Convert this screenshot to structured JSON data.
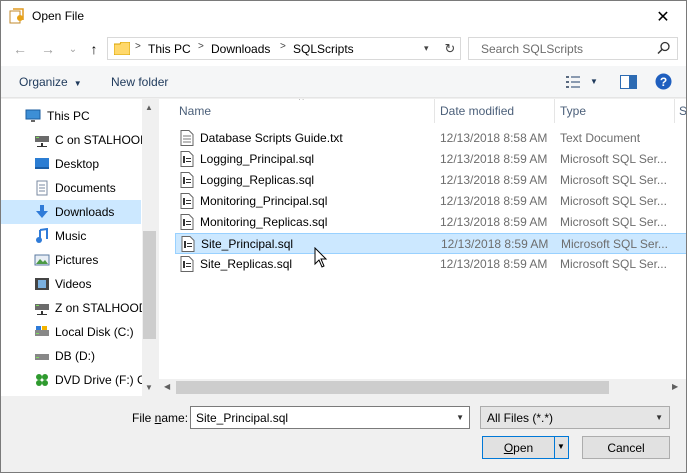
{
  "window": {
    "title": "Open File",
    "close": "✕"
  },
  "nav": {
    "back": "←",
    "forward": "→",
    "recent": "⌄",
    "up": "↑",
    "breadcrumbs": [
      "This PC",
      "Downloads",
      "SQLScripts"
    ],
    "search_placeholder": "Search SQLScripts"
  },
  "toolbar": {
    "organize": "Organize",
    "new_folder": "New folder"
  },
  "sidebar": {
    "items": [
      {
        "label": "This PC",
        "icon": "monitor-icon",
        "root": true
      },
      {
        "label": "C on STALHOOD",
        "icon": "network-drive-icon"
      },
      {
        "label": "Desktop",
        "icon": "desktop-icon"
      },
      {
        "label": "Documents",
        "icon": "documents-icon"
      },
      {
        "label": "Downloads",
        "icon": "downloads-icon",
        "selected": true
      },
      {
        "label": "Music",
        "icon": "music-icon"
      },
      {
        "label": "Pictures",
        "icon": "pictures-icon"
      },
      {
        "label": "Videos",
        "icon": "videos-icon"
      },
      {
        "label": "Z on STALHOOD",
        "icon": "network-drive-icon"
      },
      {
        "label": "Local Disk (C:)",
        "icon": "local-disk-icon"
      },
      {
        "label": "DB (D:)",
        "icon": "drive-icon"
      },
      {
        "label": "DVD Drive (F:) C\\",
        "icon": "dvd-drive-icon"
      }
    ]
  },
  "columns": {
    "name": "Name",
    "date": "Date modified",
    "type": "Type",
    "size": "S"
  },
  "files": [
    {
      "name": "Database Scripts Guide.txt",
      "date": "12/13/2018 8:58 AM",
      "type": "Text Document"
    },
    {
      "name": "Logging_Principal.sql",
      "date": "12/13/2018 8:59 AM",
      "type": "Microsoft SQL Ser..."
    },
    {
      "name": "Logging_Replicas.sql",
      "date": "12/13/2018 8:59 AM",
      "type": "Microsoft SQL Ser..."
    },
    {
      "name": "Monitoring_Principal.sql",
      "date": "12/13/2018 8:59 AM",
      "type": "Microsoft SQL Ser..."
    },
    {
      "name": "Monitoring_Replicas.sql",
      "date": "12/13/2018 8:59 AM",
      "type": "Microsoft SQL Ser..."
    },
    {
      "name": "Site_Principal.sql",
      "date": "12/13/2018 8:59 AM",
      "type": "Microsoft SQL Ser...",
      "selected": true
    },
    {
      "name": "Site_Replicas.sql",
      "date": "12/13/2018 8:59 AM",
      "type": "Microsoft SQL Ser..."
    }
  ],
  "bottom": {
    "filename_label_pre": "File ",
    "filename_label_u": "n",
    "filename_label_post": "ame:",
    "filename_value": "Site_Principal.sql",
    "filter_value": "All Files (*.*)",
    "open_u": "O",
    "open_rest": "pen",
    "cancel": "Cancel"
  },
  "colors": {
    "selection": "#cce8ff",
    "accent": "#0078d7",
    "header_text": "#4c607a"
  }
}
